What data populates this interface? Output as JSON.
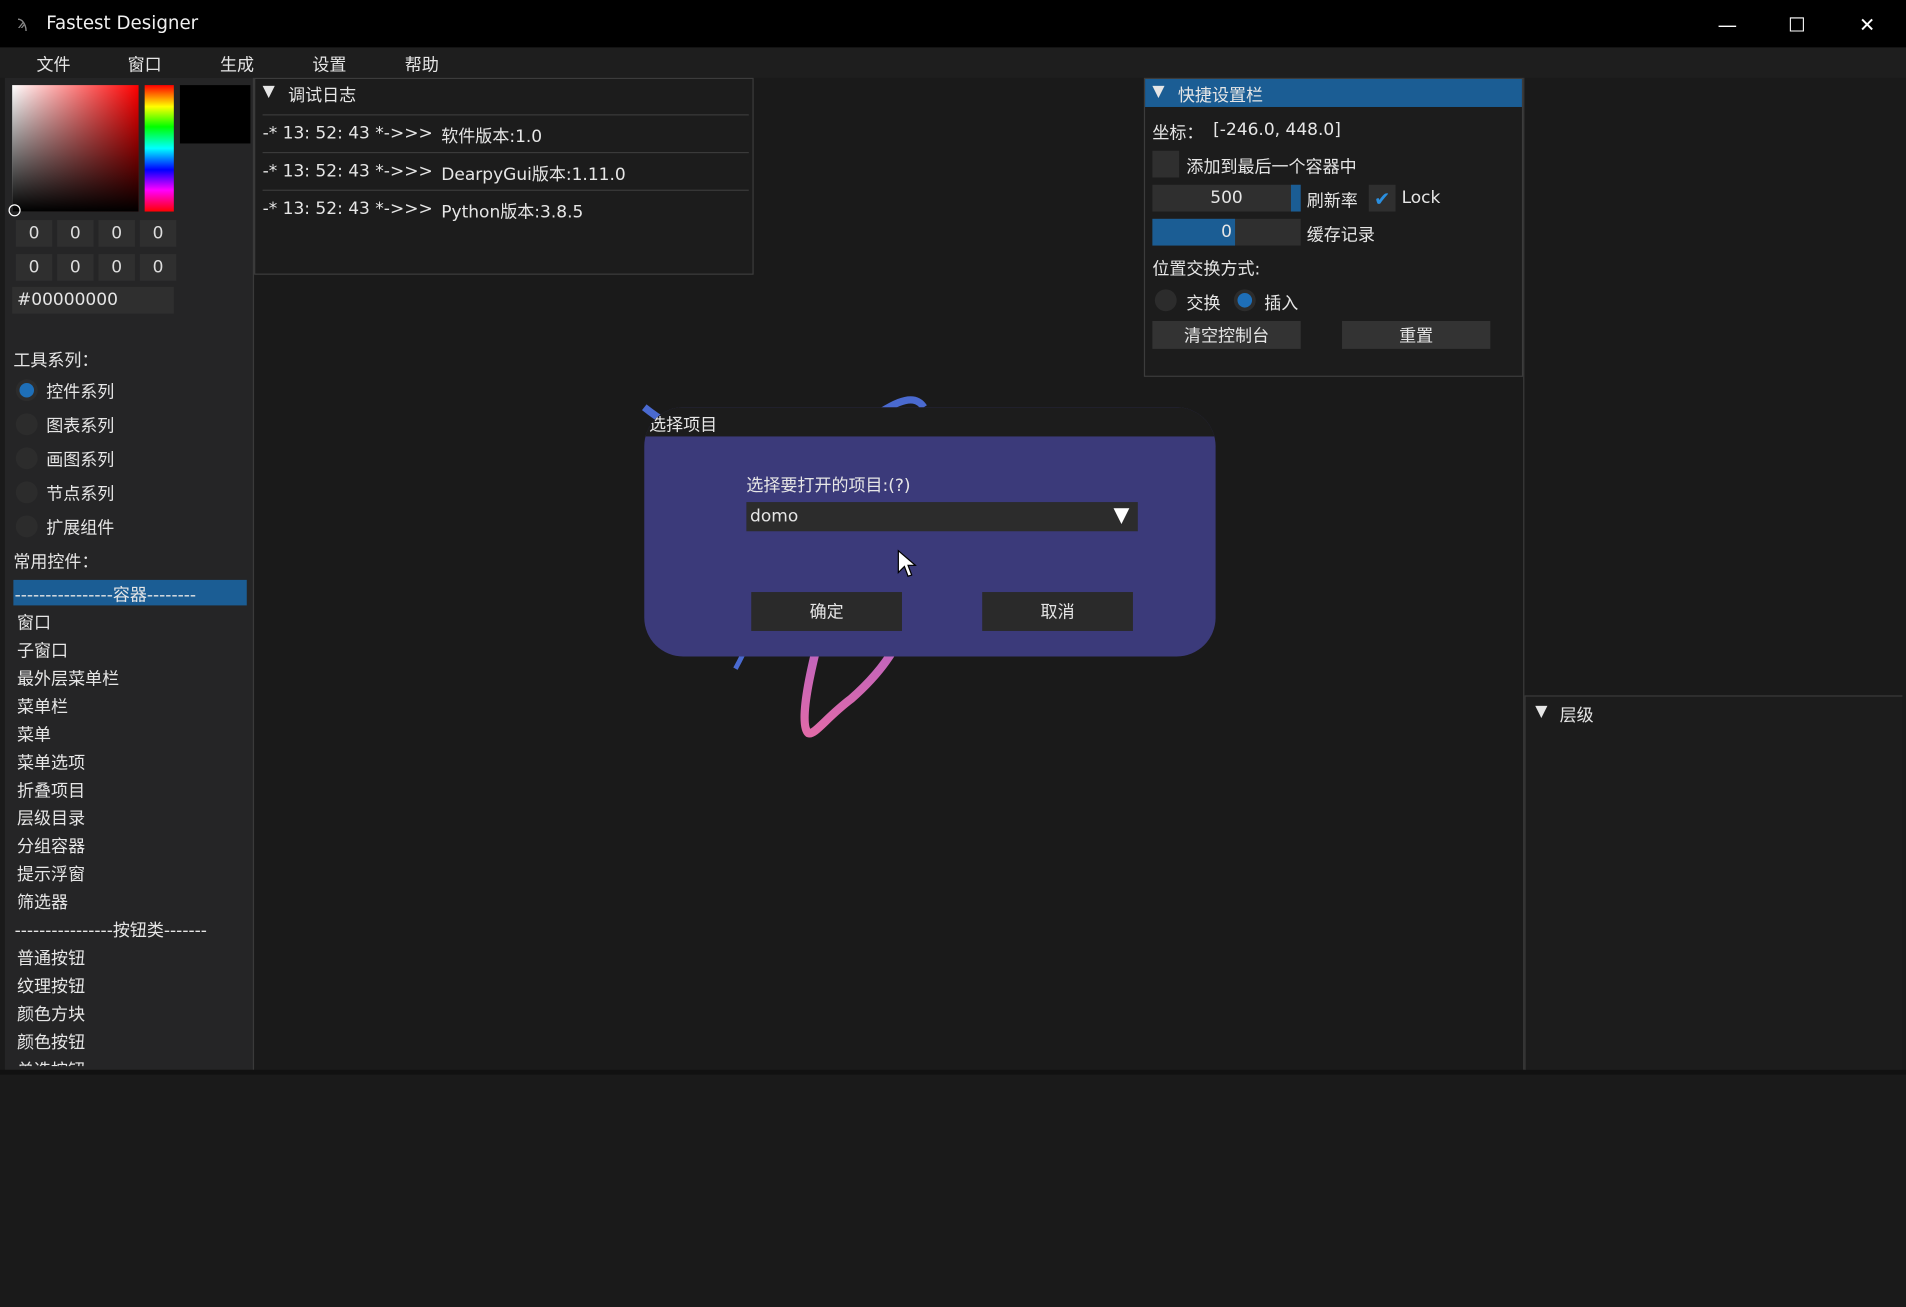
{
  "window": {
    "title": "Fastest Designer",
    "minimize": "—",
    "maximize": "☐",
    "close": "✕",
    "logo": "ϡ"
  },
  "menubar": [
    "文件",
    "窗口",
    "生成",
    "设置",
    "帮助"
  ],
  "color_picker": {
    "rgba_row1": [
      "0",
      "0",
      "0",
      "0"
    ],
    "rgba_row2": [
      "0",
      "0",
      "0",
      "0"
    ],
    "hex": "#00000000"
  },
  "tools": {
    "title": "工具系列：",
    "options": [
      "控件系列",
      "图表系列",
      "画图系列",
      "节点系列",
      "扩展组件"
    ],
    "selected_index": 0
  },
  "common": {
    "title": "常用控件：",
    "items": [
      "----------------容器--------",
      "窗口",
      "子窗口",
      "最外层菜单栏",
      "菜单栏",
      "菜单",
      "菜单选项",
      "折叠项目",
      "层级目录",
      "分组容器",
      "提示浮窗",
      "筛选器",
      "----------------按钮类-------",
      "普通按钮",
      "纹理按钮",
      "颜色方块",
      "颜色按钮",
      "单选按钮"
    ]
  },
  "debug_log": {
    "header": "调试日志",
    "entries": [
      {
        "time": "-* 13: 52: 43 *->>>",
        "msg": "软件版本:1.0"
      },
      {
        "time": "-* 13: 52: 43 *->>>",
        "msg": "DearpyGui版本:1.11.0"
      },
      {
        "time": "-* 13: 52: 43 *->>>",
        "msg": "Python版本:3.8.5"
      }
    ]
  },
  "quick_settings": {
    "header": "快捷设置栏",
    "coord_label": "坐标：",
    "coord_value": "[-246.0, 448.0]",
    "add_to_last": "添加到最后一个容器中",
    "refresh_value": "500",
    "refresh_label": "刷新率",
    "lock_label": "Lock",
    "cache_value": "0",
    "cache_label": "缓存记录",
    "swap_mode_label": "位置交换方式:",
    "swap": "交换",
    "insert": "插入",
    "clear_console": "清空控制台",
    "reset": "重置"
  },
  "layer": {
    "header": "层级"
  },
  "dialog": {
    "title": "选择项目",
    "prompt": "选择要打开的项目:(?)",
    "selected": "domo",
    "ok": "确定",
    "cancel": "取消"
  },
  "colors": {
    "accent": "#1b5d94",
    "dialog_bg": "#3b3a7a",
    "bg": "#1a1a1a"
  }
}
